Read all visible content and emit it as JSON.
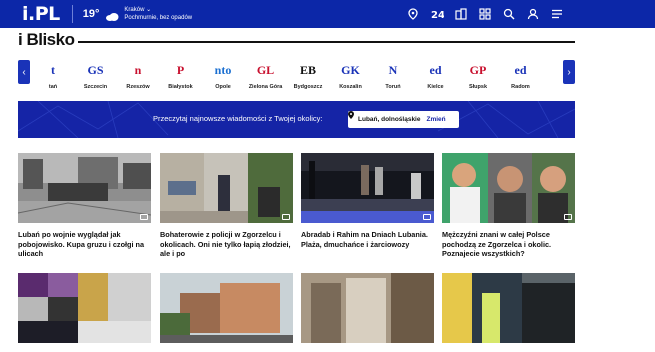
{
  "header": {
    "logo": "i.PL",
    "temperature": "19°",
    "weather_city": "Kraków",
    "weather_desc": "Pochmurnie, bez opadów",
    "icons": [
      "map-pin-icon",
      "twentyfour-icon",
      "buildings-icon",
      "grid-icon",
      "search-icon",
      "user-icon",
      "menu-icon"
    ]
  },
  "section": {
    "title": "i Blisko"
  },
  "cities": [
    {
      "logo": "t",
      "name": "tań",
      "color": "#1a33b8"
    },
    {
      "logo": "GS",
      "name": "Szczecin",
      "color": "#1a33b8"
    },
    {
      "logo": "n",
      "name": "Rzeszów",
      "color": "#c8102e"
    },
    {
      "logo": "P",
      "name": "Białystok",
      "color": "#c8102e"
    },
    {
      "logo": "nto",
      "name": "Opole",
      "color": "#1a6fd1"
    },
    {
      "logo": "GL",
      "name": "Zielona Góra",
      "color": "#c8102e"
    },
    {
      "logo": "EB",
      "name": "Bydgoszcz",
      "color": "#111111"
    },
    {
      "logo": "GK",
      "name": "Koszalin",
      "color": "#1a33b8"
    },
    {
      "logo": "N",
      "name": "Toruń",
      "color": "#1a33b8"
    },
    {
      "logo": "ed",
      "name": "Kielce",
      "color": "#1a33b8"
    },
    {
      "logo": "GP",
      "name": "Słupsk",
      "color": "#c8102e"
    },
    {
      "logo": "ed",
      "name": "Radom",
      "color": "#1a33b8"
    }
  ],
  "local_bar": {
    "text": "Przeczytaj najnowsze wiadomości z Twojej okolicy:",
    "location": "Lubań, dolnośląskie",
    "change": "Zmień"
  },
  "articles": [
    {
      "title": "Lubań po wojnie wyglądał jak pobojowisko. Kupa gruzu i czołgi na ulicach"
    },
    {
      "title": "Bohaterowie z policji w Zgorzelcu i okolicach. Oni nie tylko łapią złodziei, ale i po"
    },
    {
      "title": "Abradab i Rahim na Dniach Lubania. Plaża, dmuchańce i żarciowozy"
    },
    {
      "title": "Mężczyźni znani w całej Polsce pochodzą ze Zgorzelca i okolic. Poznajecie wszystkich?"
    }
  ],
  "accent": "#0c27a8"
}
